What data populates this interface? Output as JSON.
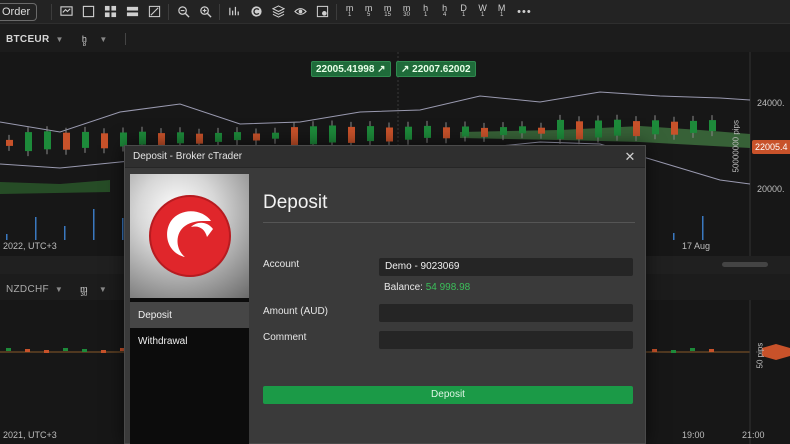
{
  "toolbar": {
    "new_order_label": "Order",
    "timeframes": [
      {
        "letter": "m",
        "num": "1"
      },
      {
        "letter": "m",
        "num": "5"
      },
      {
        "letter": "m",
        "num": "15"
      },
      {
        "letter": "m",
        "num": "30"
      },
      {
        "letter": "h",
        "num": "1"
      },
      {
        "letter": "h",
        "num": "4"
      },
      {
        "letter": "D",
        "num": "1"
      },
      {
        "letter": "W",
        "num": "1"
      },
      {
        "letter": "M",
        "num": "1"
      }
    ],
    "more_label": "•••"
  },
  "chart_top": {
    "symbol": "BTCEUR",
    "timeframe_letter": "h",
    "timeframe_num": "8",
    "bid_tag": "22005.41998",
    "ask_tag": "22007.62002",
    "price_24000": "24000.",
    "price_22005": "22005.4",
    "price_20000": "20000.",
    "pips_label": "50000000 pips",
    "date_left": "2022, UTC+3",
    "date_right": "17 Aug",
    "up_color": "#1d8a3a",
    "down_color": "#c8522a"
  },
  "chart_bottom": {
    "symbol": "NZDCHF",
    "timeframe_letter": "m",
    "timeframe_num": "30",
    "pips_label": "50 pips",
    "date_left": "2021, UTC+3",
    "time_1": "19:00",
    "time_2": "21:00"
  },
  "dialog": {
    "title": "Deposit - Broker cTrader",
    "heading": "Deposit",
    "nav": [
      "Deposit",
      "Withdrawal"
    ],
    "account_label": "Account",
    "account_value": "Demo - 9023069",
    "balance_label": "Balance:",
    "balance_value": "54 998.98",
    "amount_label": "Amount (AUD)",
    "amount_value": "",
    "comment_label": "Comment",
    "comment_value": "",
    "submit_label": "Deposit",
    "accent_color": "#1b9a47"
  }
}
